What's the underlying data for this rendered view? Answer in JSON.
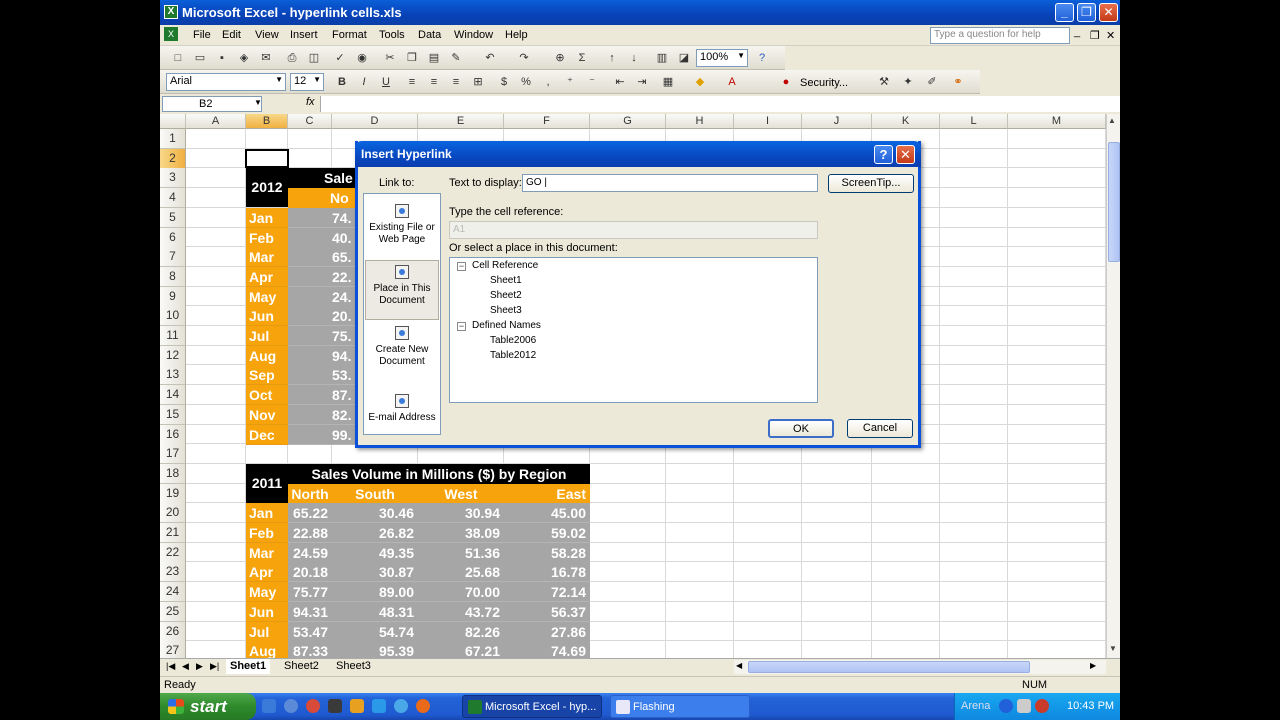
{
  "window": {
    "title": "Microsoft Excel - hyperlink cells.xls",
    "min_label": "_",
    "max_label": "❐",
    "close_label": "✕"
  },
  "menu": {
    "items": [
      "File",
      "Edit",
      "View",
      "Insert",
      "Format",
      "Tools",
      "Data",
      "Window",
      "Help"
    ],
    "help_placeholder": "Type a question for help",
    "ctrl_min": "_",
    "ctrl_restore": "❐",
    "ctrl_close": "✕"
  },
  "toolbar": {
    "zoom": "100%",
    "font": "Arial",
    "font_size": "12",
    "bold": "B",
    "italic": "I",
    "underline": "U",
    "currency": "$",
    "percent": "%",
    "sum": "Σ",
    "security": "Security..."
  },
  "formula": {
    "name_box": "B2",
    "fx": "fx"
  },
  "columns": [
    "A",
    "B",
    "C",
    "D",
    "E",
    "F",
    "G",
    "H",
    "I",
    "J",
    "K",
    "L",
    "M"
  ],
  "rows": [
    "1",
    "2",
    "3",
    "4",
    "5",
    "6",
    "7",
    "8",
    "9",
    "10",
    "11",
    "12",
    "13",
    "14",
    "15",
    "16",
    "17",
    "18",
    "19",
    "20",
    "21",
    "22",
    "23",
    "24",
    "25",
    "26",
    "27"
  ],
  "active_cell": {
    "col": "B",
    "row": "2"
  },
  "table2012": {
    "year": "2012",
    "title_partial": "Sale",
    "header_partial": "No",
    "months": [
      "Jan",
      "Feb",
      "Mar",
      "Apr",
      "May",
      "Jun",
      "Jul",
      "Aug",
      "Sep",
      "Oct",
      "Nov",
      "Dec"
    ],
    "north_partial": [
      "74.",
      "40.",
      "65.",
      "22.",
      "24.",
      "20.",
      "75.",
      "94.",
      "53.",
      "87.",
      "82.",
      "99."
    ]
  },
  "table2011": {
    "year": "2011",
    "title": "Sales Volume in Millions ($) by Region",
    "headers": [
      "North",
      "South",
      "West",
      "East"
    ],
    "months": [
      "Jan",
      "Feb",
      "Mar",
      "Apr",
      "May",
      "Jun",
      "Jul",
      "Aug"
    ],
    "values": [
      [
        "65.22",
        "30.46",
        "30.94",
        "45.00"
      ],
      [
        "22.88",
        "26.82",
        "38.09",
        "59.02"
      ],
      [
        "24.59",
        "49.35",
        "51.36",
        "58.28"
      ],
      [
        "20.18",
        "30.87",
        "25.68",
        "16.78"
      ],
      [
        "75.77",
        "89.00",
        "70.00",
        "72.14"
      ],
      [
        "94.31",
        "48.31",
        "43.72",
        "56.37"
      ],
      [
        "53.47",
        "54.74",
        "82.26",
        "27.86"
      ],
      [
        "87.33",
        "95.39",
        "67.21",
        "74.69"
      ]
    ]
  },
  "sheets": [
    "Sheet1",
    "Sheet2",
    "Sheet3"
  ],
  "status": {
    "ready": "Ready",
    "num": "NUM"
  },
  "dialog": {
    "title": "Insert Hyperlink",
    "help_label": "?",
    "close_label": "✕",
    "link_to": "Link to:",
    "link_options": [
      "Existing File or Web Page",
      "Place in This Document",
      "Create New Document",
      "E-mail Address"
    ],
    "text_to_display_label": "Text to display:",
    "text_to_display_value": "GO |",
    "screentip": "ScreenTip...",
    "cell_ref_label": "Type the cell reference:",
    "cell_ref_value": "A1",
    "select_place_label": "Or select a place in this document:",
    "tree": {
      "cell_reference": "Cell Reference",
      "sheets": [
        "Sheet1",
        "Sheet2",
        "Sheet3"
      ],
      "defined_names": "Defined Names",
      "names": [
        "Table2006",
        "Table2012"
      ]
    },
    "ok": "OK",
    "cancel": "Cancel"
  },
  "taskbar": {
    "start": "start",
    "items": [
      "Microsoft Excel - hyp...",
      "Flashing"
    ],
    "tray_text": "Arena",
    "clock": "10:43 PM"
  },
  "colors": {
    "orange": "#f7a30b",
    "gray": "#a6a6a6",
    "black": "#000000",
    "xp_blue": "#0a50d8"
  }
}
